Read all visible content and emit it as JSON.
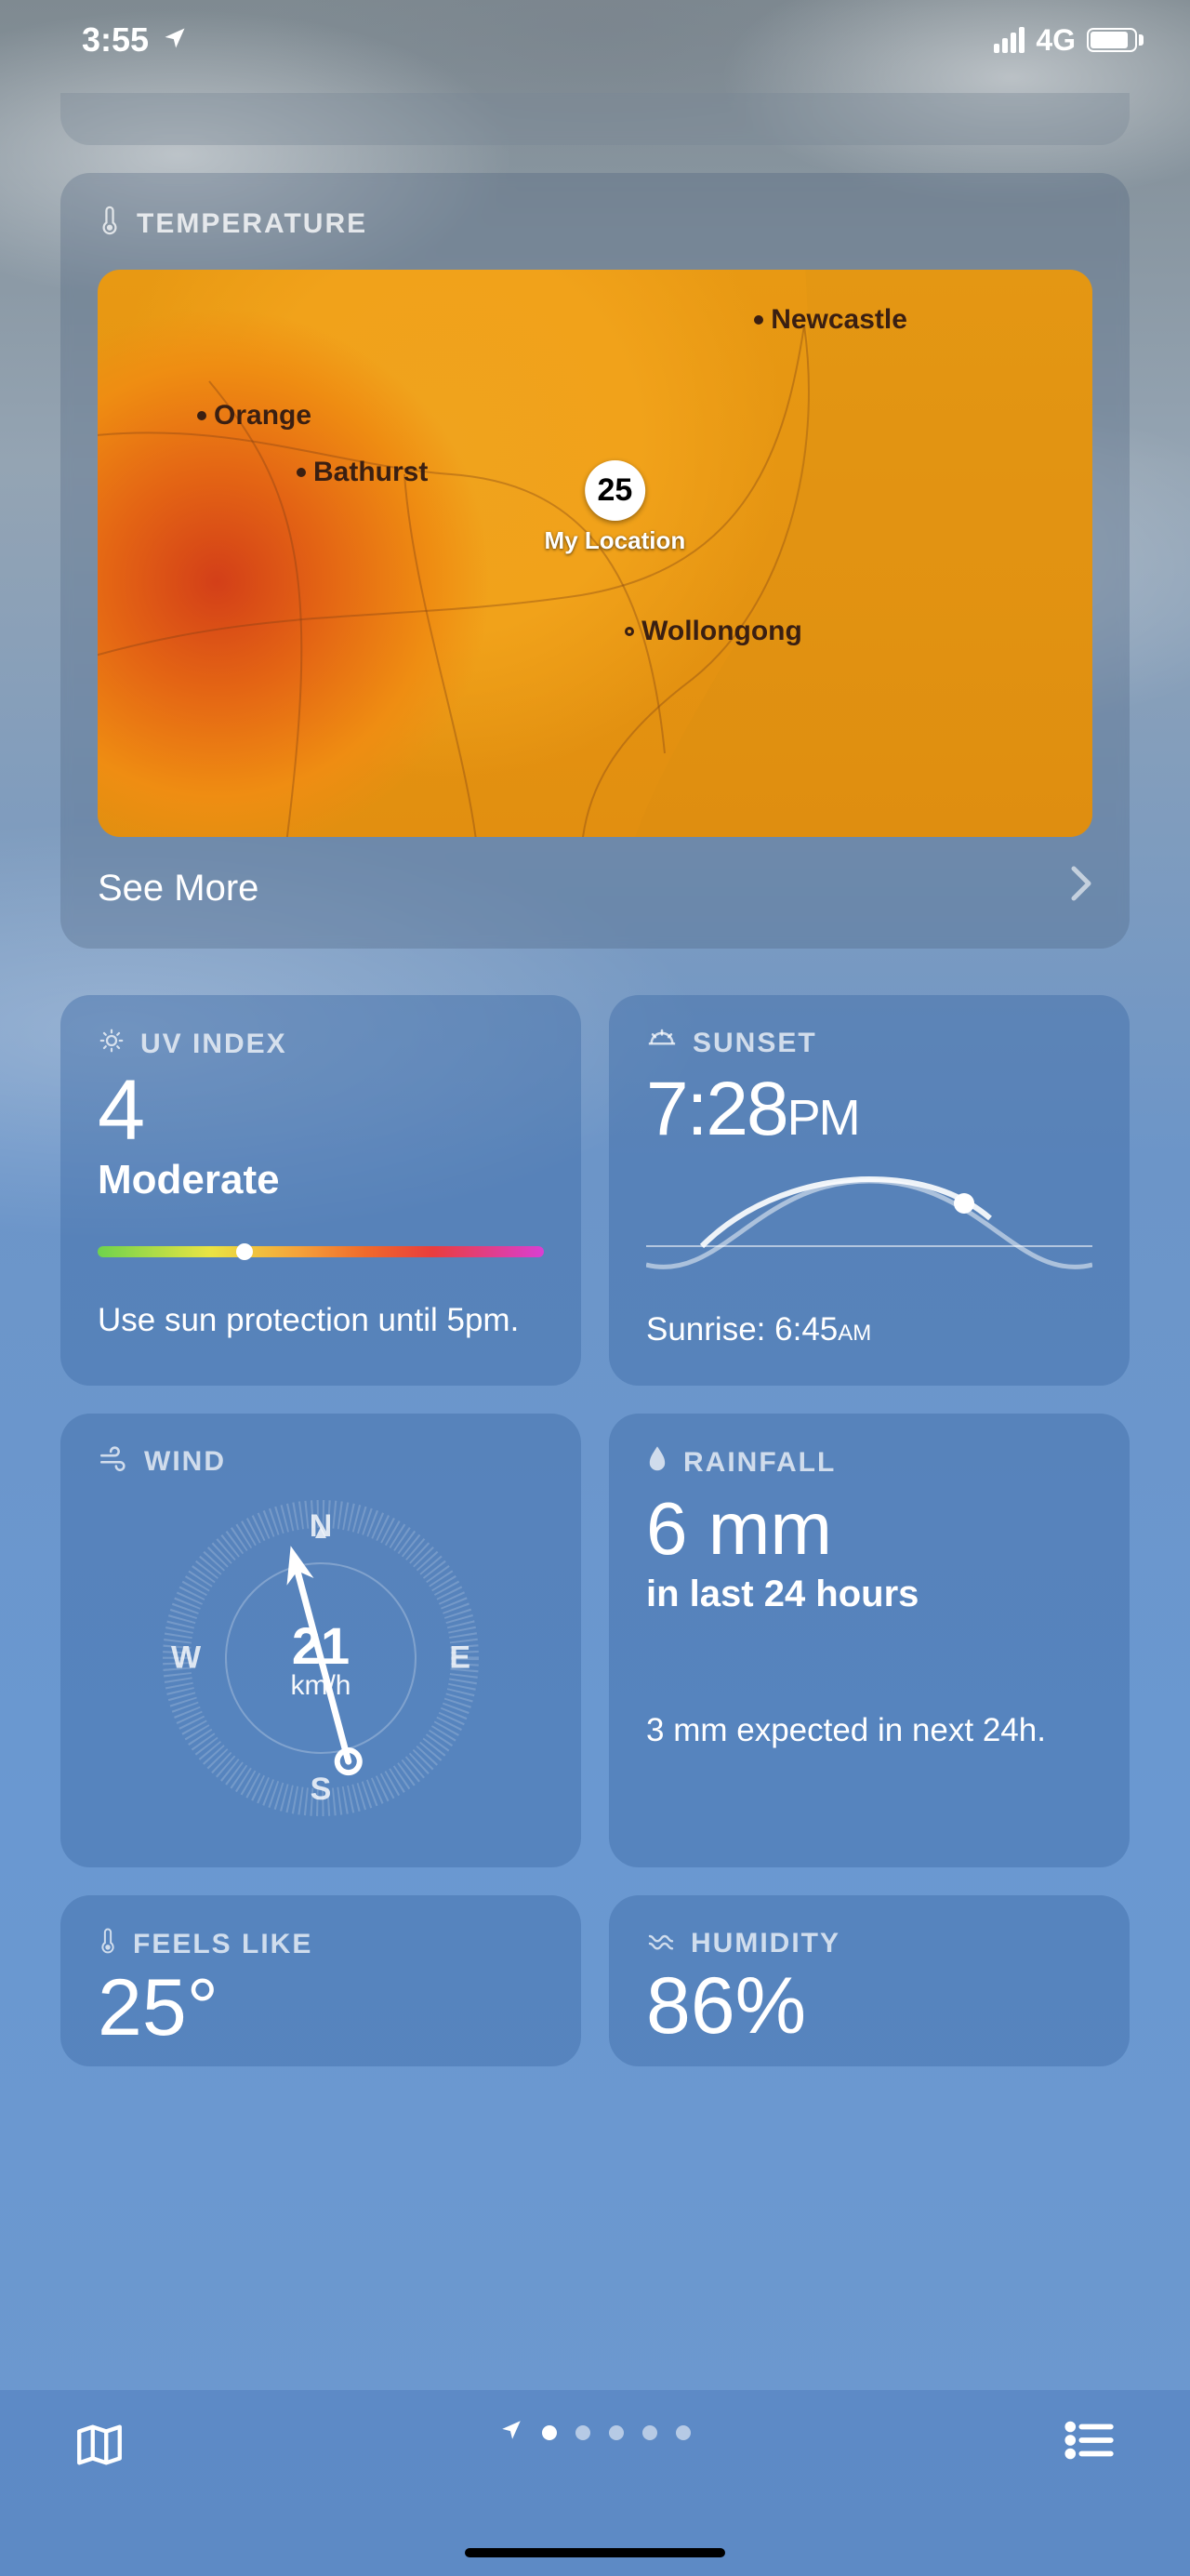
{
  "status": {
    "time": "3:55",
    "network": "4G"
  },
  "temperature_card": {
    "label": "TEMPERATURE",
    "pin_value": "25",
    "pin_label": "My Location",
    "cities": {
      "newcastle": "Newcastle",
      "orange": "Orange",
      "bathurst": "Bathurst",
      "wollongong": "Wollongong"
    },
    "see_more": "See More"
  },
  "uv": {
    "label": "UV INDEX",
    "value": "4",
    "level": "Moderate",
    "marker_percent": 33,
    "advice": "Use sun protection until 5pm."
  },
  "sunset": {
    "label": "SUNSET",
    "time": "7:28",
    "ampm": "PM",
    "sunrise_label": "Sunrise: ",
    "sunrise_time": "6:45",
    "sunrise_ampm": "AM"
  },
  "wind": {
    "label": "WIND",
    "speed": "21",
    "unit": "km/h",
    "n": "N",
    "s": "S",
    "e": "E",
    "w": "W"
  },
  "rainfall": {
    "label": "RAINFALL",
    "value": "6 mm",
    "period": "in last 24 hours",
    "forecast": "3 mm expected in next 24h."
  },
  "feels_like": {
    "label": "FEELS LIKE",
    "value": "25°"
  },
  "humidity": {
    "label": "HUMIDITY",
    "value": "86%"
  }
}
